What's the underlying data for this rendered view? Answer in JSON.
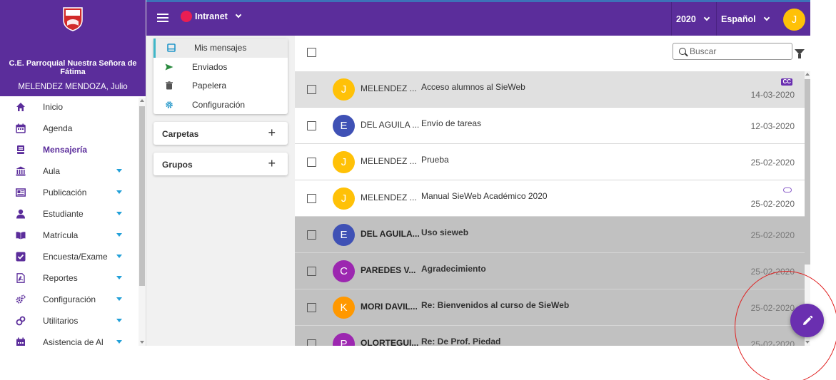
{
  "sidebar": {
    "logo_text": "NSF",
    "school_name": "C.E. Parroquial Nuestra Señora de Fátima",
    "user_name": "MELENDEZ MENDOZA, Julio",
    "items": [
      {
        "label": "Inicio",
        "icon": "home-icon"
      },
      {
        "label": "Agenda",
        "icon": "calendar-icon"
      },
      {
        "label": "Mensajería",
        "icon": "inbox-icon",
        "active": true
      },
      {
        "label": "Aula",
        "icon": "institution-icon",
        "expandable": true
      },
      {
        "label": "Publicación",
        "icon": "newspaper-icon",
        "expandable": true
      },
      {
        "label": "Estudiante",
        "icon": "student-icon",
        "expandable": true
      },
      {
        "label": "Matrícula",
        "icon": "book-icon",
        "expandable": true
      },
      {
        "label": "Encuesta/Exame",
        "icon": "checkbox-icon",
        "expandable": true
      },
      {
        "label": "Reportes",
        "icon": "pdf-icon",
        "expandable": true
      },
      {
        "label": "Configuración",
        "icon": "gears-icon",
        "expandable": true
      },
      {
        "label": "Utilitarios",
        "icon": "tools-icon",
        "expandable": true
      },
      {
        "label": "Asistencia de Al",
        "icon": "calendar-check-icon",
        "expandable": true
      }
    ]
  },
  "topbar": {
    "menu_icon": "hamburger-icon",
    "app_selector": "Intranet",
    "year": "2020",
    "language": "Español",
    "avatar_letter": "J"
  },
  "folders": {
    "items": [
      {
        "label": "Mis mensajes",
        "icon": "inbox-icon",
        "active": true
      },
      {
        "label": "Enviados",
        "icon": "send-icon"
      },
      {
        "label": "Papelera",
        "icon": "trash-icon"
      },
      {
        "label": "Configuración",
        "icon": "gear-icon"
      }
    ],
    "carpetas": "Carpetas",
    "grupos": "Grupos",
    "add_symbol": "+"
  },
  "messages": {
    "search_placeholder": "Buscar",
    "rows": [
      {
        "avatar": "J",
        "avatar_color": "#ffc107",
        "sender": "MELENDEZ ...",
        "subject": "Acceso alumnos al SieWeb",
        "date": "14-03-2020",
        "state": "selected",
        "badge": "CC"
      },
      {
        "avatar": "E",
        "avatar_color": "#3f51b5",
        "sender": "DEL AGUILA ...",
        "subject": "Envío de tareas",
        "date": "12-03-2020",
        "state": "read"
      },
      {
        "avatar": "J",
        "avatar_color": "#ffc107",
        "sender": "MELENDEZ ...",
        "subject": "Prueba",
        "date": "25-02-2020",
        "state": "read"
      },
      {
        "avatar": "J",
        "avatar_color": "#ffc107",
        "sender": "MELENDEZ ...",
        "subject": "Manual SieWeb Académico 2020",
        "date": "25-02-2020",
        "state": "read",
        "attachment": true
      },
      {
        "avatar": "E",
        "avatar_color": "#3f51b5",
        "sender": "DEL AGUILA...",
        "subject": "Uso sieweb",
        "date": "25-02-2020",
        "state": "unread"
      },
      {
        "avatar": "C",
        "avatar_color": "#9c27b0",
        "sender": "PAREDES V...",
        "subject": "Agradecimiento",
        "date": "25-02-2020",
        "state": "unread"
      },
      {
        "avatar": "K",
        "avatar_color": "#ff9800",
        "sender": "MORI DAVIL...",
        "subject": "Re: Bienvenidos al curso de SieWeb",
        "date": "25-02-2020",
        "state": "unread"
      },
      {
        "avatar": "P",
        "avatar_color": "#9c27b0",
        "sender": "OLORTEGUI...",
        "subject": "Re: De Prof. Piedad",
        "date": "25-02-2020",
        "state": "unread"
      }
    ]
  },
  "fab": {
    "icon": "pencil-icon",
    "color": "#6a2fb0"
  },
  "colors": {
    "primary": "#5b2d9b",
    "accent": "#22a0d8",
    "annotation": "#e02020"
  }
}
